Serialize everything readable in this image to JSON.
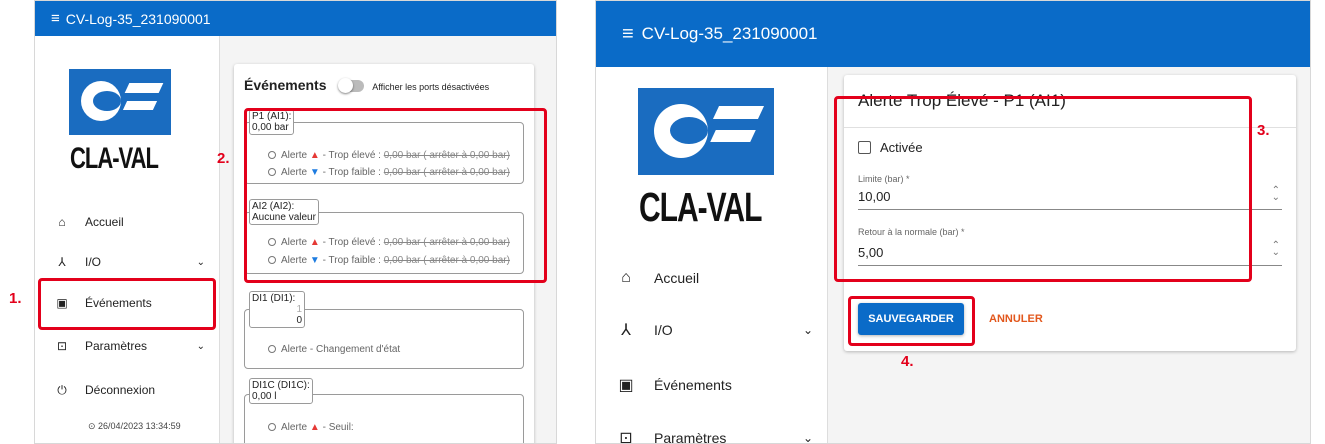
{
  "left": {
    "app_title": "CV-Log-35_231090001",
    "logo_text": "CLA-VAL",
    "nav": [
      {
        "label": "Accueil",
        "icon": "home-icon"
      },
      {
        "label": "I/O",
        "icon": "io-icon"
      },
      {
        "label": "Événements",
        "icon": "calendar-icon"
      },
      {
        "label": "Paramètres",
        "icon": "settings-icon"
      },
      {
        "label": "Déconnexion",
        "icon": "power-icon"
      }
    ],
    "timestamp": "⊙ 26/04/2023 13:34:59",
    "events": {
      "title": "Événements",
      "toggle_label": "Afficher les ports désactivées",
      "groups": [
        {
          "legend_line1": "P1 (AI1):",
          "legend_line2": "0,00 bar",
          "alerts": [
            {
              "prefix": "Alerte",
              "arrow": "▲",
              "text": " - Trop élevé : ",
              "struck": "0,00 bar ( arrêter à 0,00 bar)"
            },
            {
              "prefix": "Alerte",
              "arrow": "▼",
              "text": " - Trop faible : ",
              "struck": "0,00 bar ( arrêter à 0,00 bar)"
            }
          ]
        },
        {
          "legend_line1": "AI2 (AI2):",
          "legend_line2": "Aucune valeur",
          "alerts": [
            {
              "prefix": "Alerte",
              "arrow": "▲",
              "text": " - Trop élevé : ",
              "struck": "0,00 bar ( arrêter à 0,00 bar)"
            },
            {
              "prefix": "Alerte",
              "arrow": "▼",
              "text": " - Trop faible : ",
              "struck": "0,00 bar ( arrêter à 0,00 bar)"
            }
          ]
        },
        {
          "legend_line1": "DI1 (DI1):",
          "legend_line2": "1",
          "legend_line3": "0",
          "alerts": [
            {
              "prefix": "Alerte",
              "text": " - Changement d'état"
            }
          ]
        },
        {
          "legend_line1": "DI1C (DI1C):",
          "legend_line2": "0,00 l",
          "alerts": [
            {
              "prefix": "Alerte",
              "arrow": "▲",
              "text": " - Seuil:"
            }
          ]
        }
      ]
    }
  },
  "right": {
    "app_title": "CV-Log-35_231090001",
    "logo_text": "CLA-VAL",
    "nav": [
      {
        "label": "Accueil"
      },
      {
        "label": "I/O"
      },
      {
        "label": "Événements"
      },
      {
        "label": "Paramètres"
      }
    ],
    "form": {
      "title": "Alerte Trop Élevé - P1 (AI1)",
      "enabled_label": "Activée",
      "limit_label": "Limite (bar) *",
      "limit_value": "10,00",
      "return_label": "Retour à la normale (bar) *",
      "return_value": "5,00",
      "save_label": "SAUVEGARDER",
      "cancel_label": "ANNULER"
    }
  },
  "steps": [
    "1.",
    "2.",
    "3.",
    "4."
  ],
  "colors": {
    "primary": "#0a6bc8",
    "highlight": "#e3001b",
    "cancel": "#e2571c"
  }
}
